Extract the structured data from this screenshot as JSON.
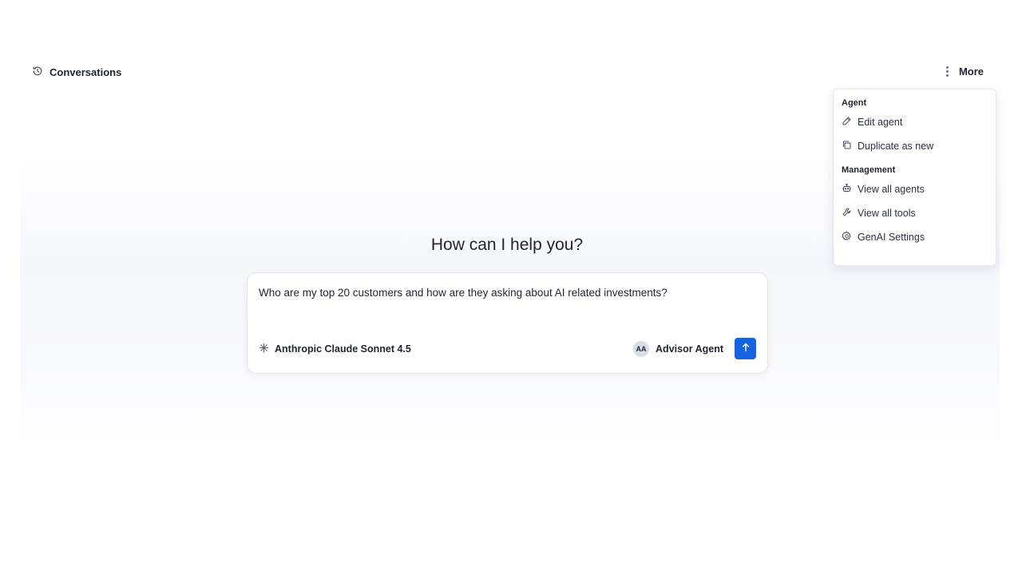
{
  "header": {
    "conversations_label": "Conversations",
    "more_label": "More"
  },
  "menu": {
    "section_agent": "Agent",
    "edit_agent": "Edit agent",
    "duplicate": "Duplicate as new",
    "section_management": "Management",
    "view_agents": "View all agents",
    "view_tools": "View all tools",
    "settings": "GenAI Settings"
  },
  "main": {
    "heading": "How can I help you?"
  },
  "composer": {
    "prompt": "Who are my top 20 customers and how are they asking about AI related investments?",
    "model_label": "Anthropic Claude Sonnet 4.5",
    "agent_initials": "AA",
    "agent_label": "Advisor Agent"
  },
  "colors": {
    "accent": "#1463e0",
    "text": "#1f2430"
  }
}
